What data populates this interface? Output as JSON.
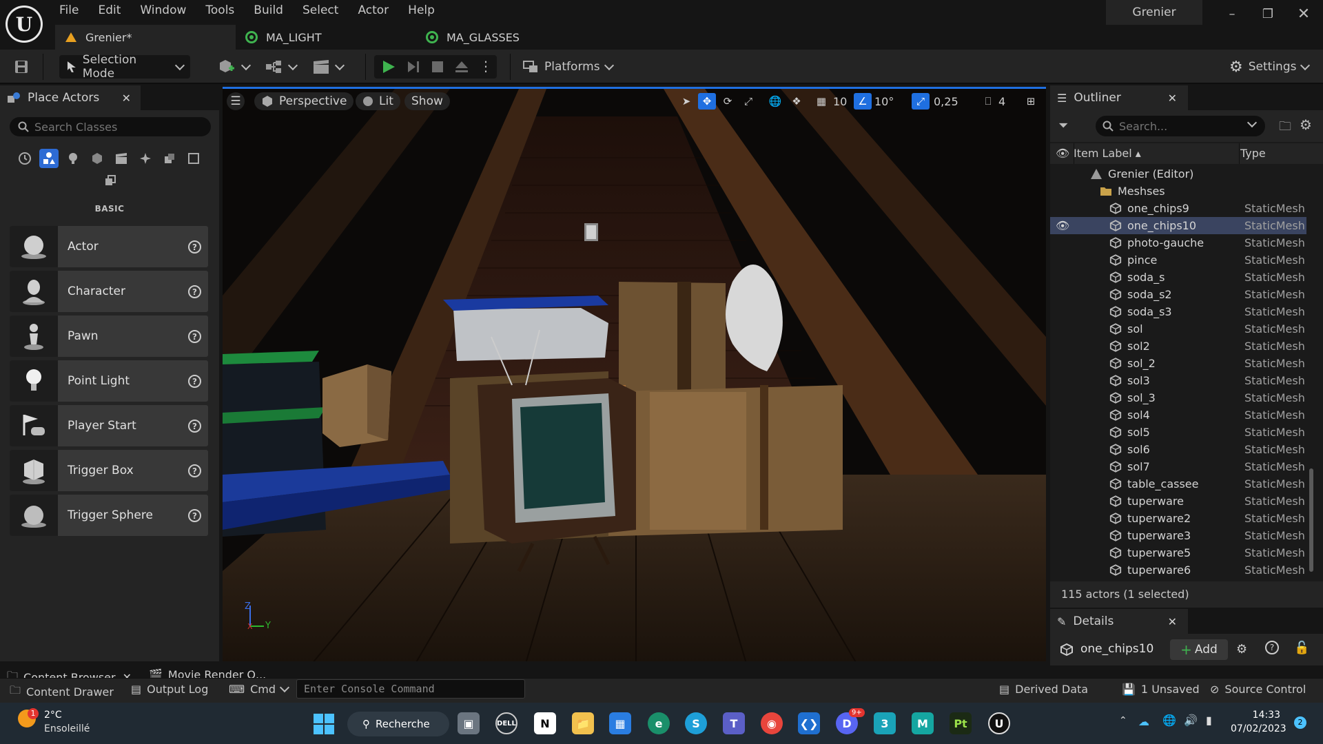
{
  "window": {
    "menu": [
      "File",
      "Edit",
      "Window",
      "Tools",
      "Build",
      "Select",
      "Actor",
      "Help"
    ],
    "project": "Grenier",
    "tabs": [
      {
        "label": "Grenier*"
      },
      {
        "label": "MA_LIGHT"
      },
      {
        "label": "MA_GLASSES"
      }
    ]
  },
  "toolbar": {
    "selection_mode": "Selection Mode",
    "platforms": "Platforms",
    "settings": "Settings"
  },
  "place_actors": {
    "title": "Place Actors",
    "search_placeholder": "Search Classes",
    "category": "BASIC",
    "items": [
      "Actor",
      "Character",
      "Pawn",
      "Point Light",
      "Player Start",
      "Trigger Box",
      "Trigger Sphere"
    ]
  },
  "viewport": {
    "view_mode": "Perspective",
    "lighting": "Lit",
    "show": "Show",
    "grid_snap": "10",
    "rotation_snap": "10°",
    "scale_snap": "0,25",
    "camera_speed": "4",
    "axis_z": "Z",
    "axis_y": "Y",
    "axis_x": "X"
  },
  "outliner": {
    "title": "Outliner",
    "search_placeholder": "Search...",
    "col_label": "Item Label",
    "col_type": "Type",
    "root": "Grenier (Editor)",
    "folder": "Meshses",
    "rows": [
      {
        "label": "one_chips9",
        "type": "StaticMesh"
      },
      {
        "label": "one_chips10",
        "type": "StaticMesh",
        "selected": true
      },
      {
        "label": "photo-gauche",
        "type": "StaticMesh"
      },
      {
        "label": "pince",
        "type": "StaticMesh"
      },
      {
        "label": "soda_s",
        "type": "StaticMesh"
      },
      {
        "label": "soda_s2",
        "type": "StaticMesh"
      },
      {
        "label": "soda_s3",
        "type": "StaticMesh"
      },
      {
        "label": "sol",
        "type": "StaticMesh"
      },
      {
        "label": "sol2",
        "type": "StaticMesh"
      },
      {
        "label": "sol_2",
        "type": "StaticMesh"
      },
      {
        "label": "sol3",
        "type": "StaticMesh"
      },
      {
        "label": "sol_3",
        "type": "StaticMesh"
      },
      {
        "label": "sol4",
        "type": "StaticMesh"
      },
      {
        "label": "sol5",
        "type": "StaticMesh"
      },
      {
        "label": "sol6",
        "type": "StaticMesh"
      },
      {
        "label": "sol7",
        "type": "StaticMesh"
      },
      {
        "label": "table_cassee",
        "type": "StaticMesh"
      },
      {
        "label": "tuperware",
        "type": "StaticMesh"
      },
      {
        "label": "tuperware2",
        "type": "StaticMesh"
      },
      {
        "label": "tuperware3",
        "type": "StaticMesh"
      },
      {
        "label": "tuperware5",
        "type": "StaticMesh"
      },
      {
        "label": "tuperware6",
        "type": "StaticMesh"
      }
    ],
    "count": "115 actors (1 selected)"
  },
  "details": {
    "title": "Details",
    "selected": "one_chips10",
    "add": "Add"
  },
  "bottom": {
    "content_browser": "Content Browser",
    "movie_render": "Movie Render Q...",
    "content_drawer": "Content Drawer",
    "output_log": "Output Log",
    "cmd": "Cmd",
    "console_placeholder": "Enter Console Command",
    "derived_data": "Derived Data",
    "unsaved": "1 Unsaved",
    "source_control": "Source Control"
  },
  "taskbar": {
    "temp": "2°C",
    "weather": "Ensoleillé",
    "weather_badge": "1",
    "search": "Recherche",
    "discord_badge": "9+",
    "time": "14:33",
    "date": "07/02/2023",
    "notif_count": "2"
  },
  "colors": {
    "accent": "#1f6fe0",
    "panel": "#242424",
    "background": "#151515",
    "play_green": "#3fb34f"
  }
}
